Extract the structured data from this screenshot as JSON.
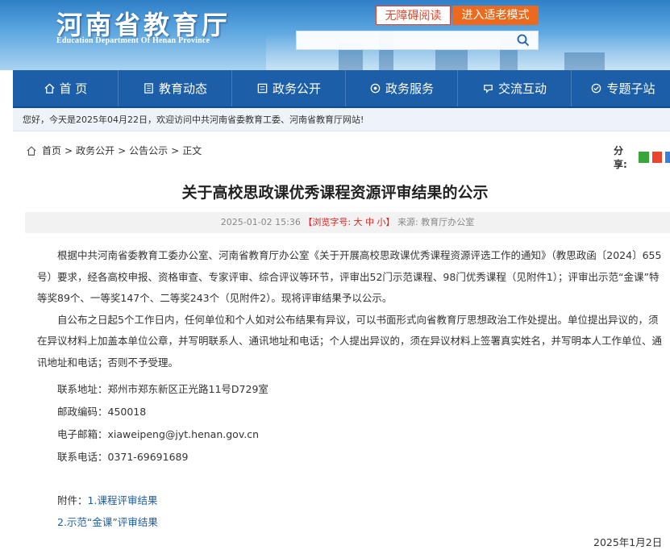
{
  "header": {
    "logo_cn": "河南省教育厅",
    "logo_en": "Education Department Of Henan Province",
    "accessibility_label": "无障碍阅读",
    "elder_mode_label": "进入适老模式",
    "search_icon": "search-icon"
  },
  "nav": {
    "items": [
      {
        "label": "首 页",
        "icon": "home-icon"
      },
      {
        "label": "教育动态",
        "icon": "news-icon"
      },
      {
        "label": "政务公开",
        "icon": "document-icon"
      },
      {
        "label": "政务服务",
        "icon": "service-icon"
      },
      {
        "label": "交流互动",
        "icon": "interaction-icon"
      },
      {
        "label": "专题子站",
        "icon": "topic-icon"
      }
    ],
    "colors": {
      "bar": "#1d5ea8"
    }
  },
  "welcome": "您好，今天是2025年04月22日，欢迎访问中共河南省委教育工委、河南省教育厅网站!",
  "breadcrumb": {
    "home": "首页",
    "sep1": ">",
    "section": "政务公开",
    "sep2": ">",
    "sub": "公告公示",
    "sep3": ">",
    "current": "正文"
  },
  "share": {
    "label": "分享:"
  },
  "article": {
    "title": "关于高校思政课优秀课程资源评审结果的公示",
    "meta_date": "2025-01-02 15:36",
    "meta_font": "【浏览字号: 大 中 小】",
    "meta_source": "来源: 教育厅办公室",
    "paragraphs": [
      "根据中共河南省委教育工委办公室、河南省教育厅办公室《关于开展高校思政课优秀课程资源评选工作的通知》（教思政函〔2024〕655号）要求，经各高校申报、资格审查、专家评审、综合评议等环节，评审出52门示范课程、98门优秀课程（见附件1）；评审出示范“金课”特等奖89个、一等奖147个、二等奖243个（见附件2）。现将评审结果予以公示。",
      "自公布之日起5个工作日内，任何单位和个人如对公布结果有异议，可以书面形式向省教育厅思想政治工作处提出。单位提出异议的，须在异议材料上加盖本单位公章，并写明联系人、通讯地址和电话；个人提出异议的，须在异议材料上签署真实姓名，并写明本人工作单位、通讯地址和电话；否则不予受理。"
    ],
    "contact": {
      "address": "联系地址：郑州市郑东新区正光路11号D729室",
      "postcode": "邮政编码：450018",
      "email": "电子邮箱：xiaweipeng@jyt.henan.gov.cn",
      "phone": "联系电话：0371-69691689"
    },
    "attachments_label": "附件：",
    "attachment_1": "1.课程评审结果",
    "attachment_2": "2.示范“金课”评审结果",
    "sign_date": "2025年1月2日"
  }
}
